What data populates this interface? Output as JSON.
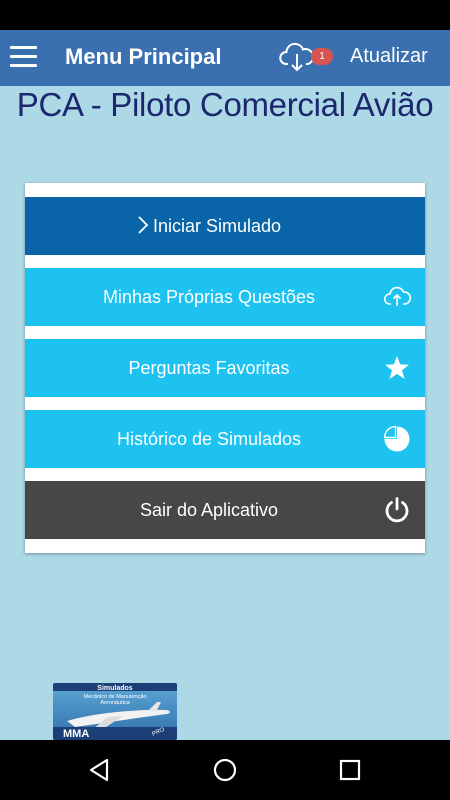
{
  "app_bar": {
    "title": "Menu Principal",
    "update_badge": "1",
    "update_label": "Atualizar",
    "color": "#3a6fb0"
  },
  "page": {
    "heading": "PCA - Piloto Comercial Avião",
    "background": "#add8e6"
  },
  "menu": {
    "items": [
      {
        "label": "Iniciar Simulado",
        "icon": "chevron-right-icon",
        "color": "#0a65a8"
      },
      {
        "label": "Minhas Próprias Questões",
        "icon": "cloud-upload-icon",
        "color": "#1ec2f0"
      },
      {
        "label": "Perguntas Favoritas",
        "icon": "star-icon",
        "color": "#1ec2f0"
      },
      {
        "label": "Histórico de Simulados",
        "icon": "pie-chart-icon",
        "color": "#1ec2f0"
      },
      {
        "label": "Sair do Aplicativo",
        "icon": "power-icon",
        "color": "#474747"
      }
    ]
  },
  "banner": {
    "line1": "Simulados",
    "line2": "Mecânico de Manutenção",
    "line3": "Aeronáutica",
    "brand": "MMA",
    "tag": "PRO"
  },
  "nav": {
    "icons": [
      "back-icon",
      "home-icon",
      "recents-icon"
    ]
  }
}
